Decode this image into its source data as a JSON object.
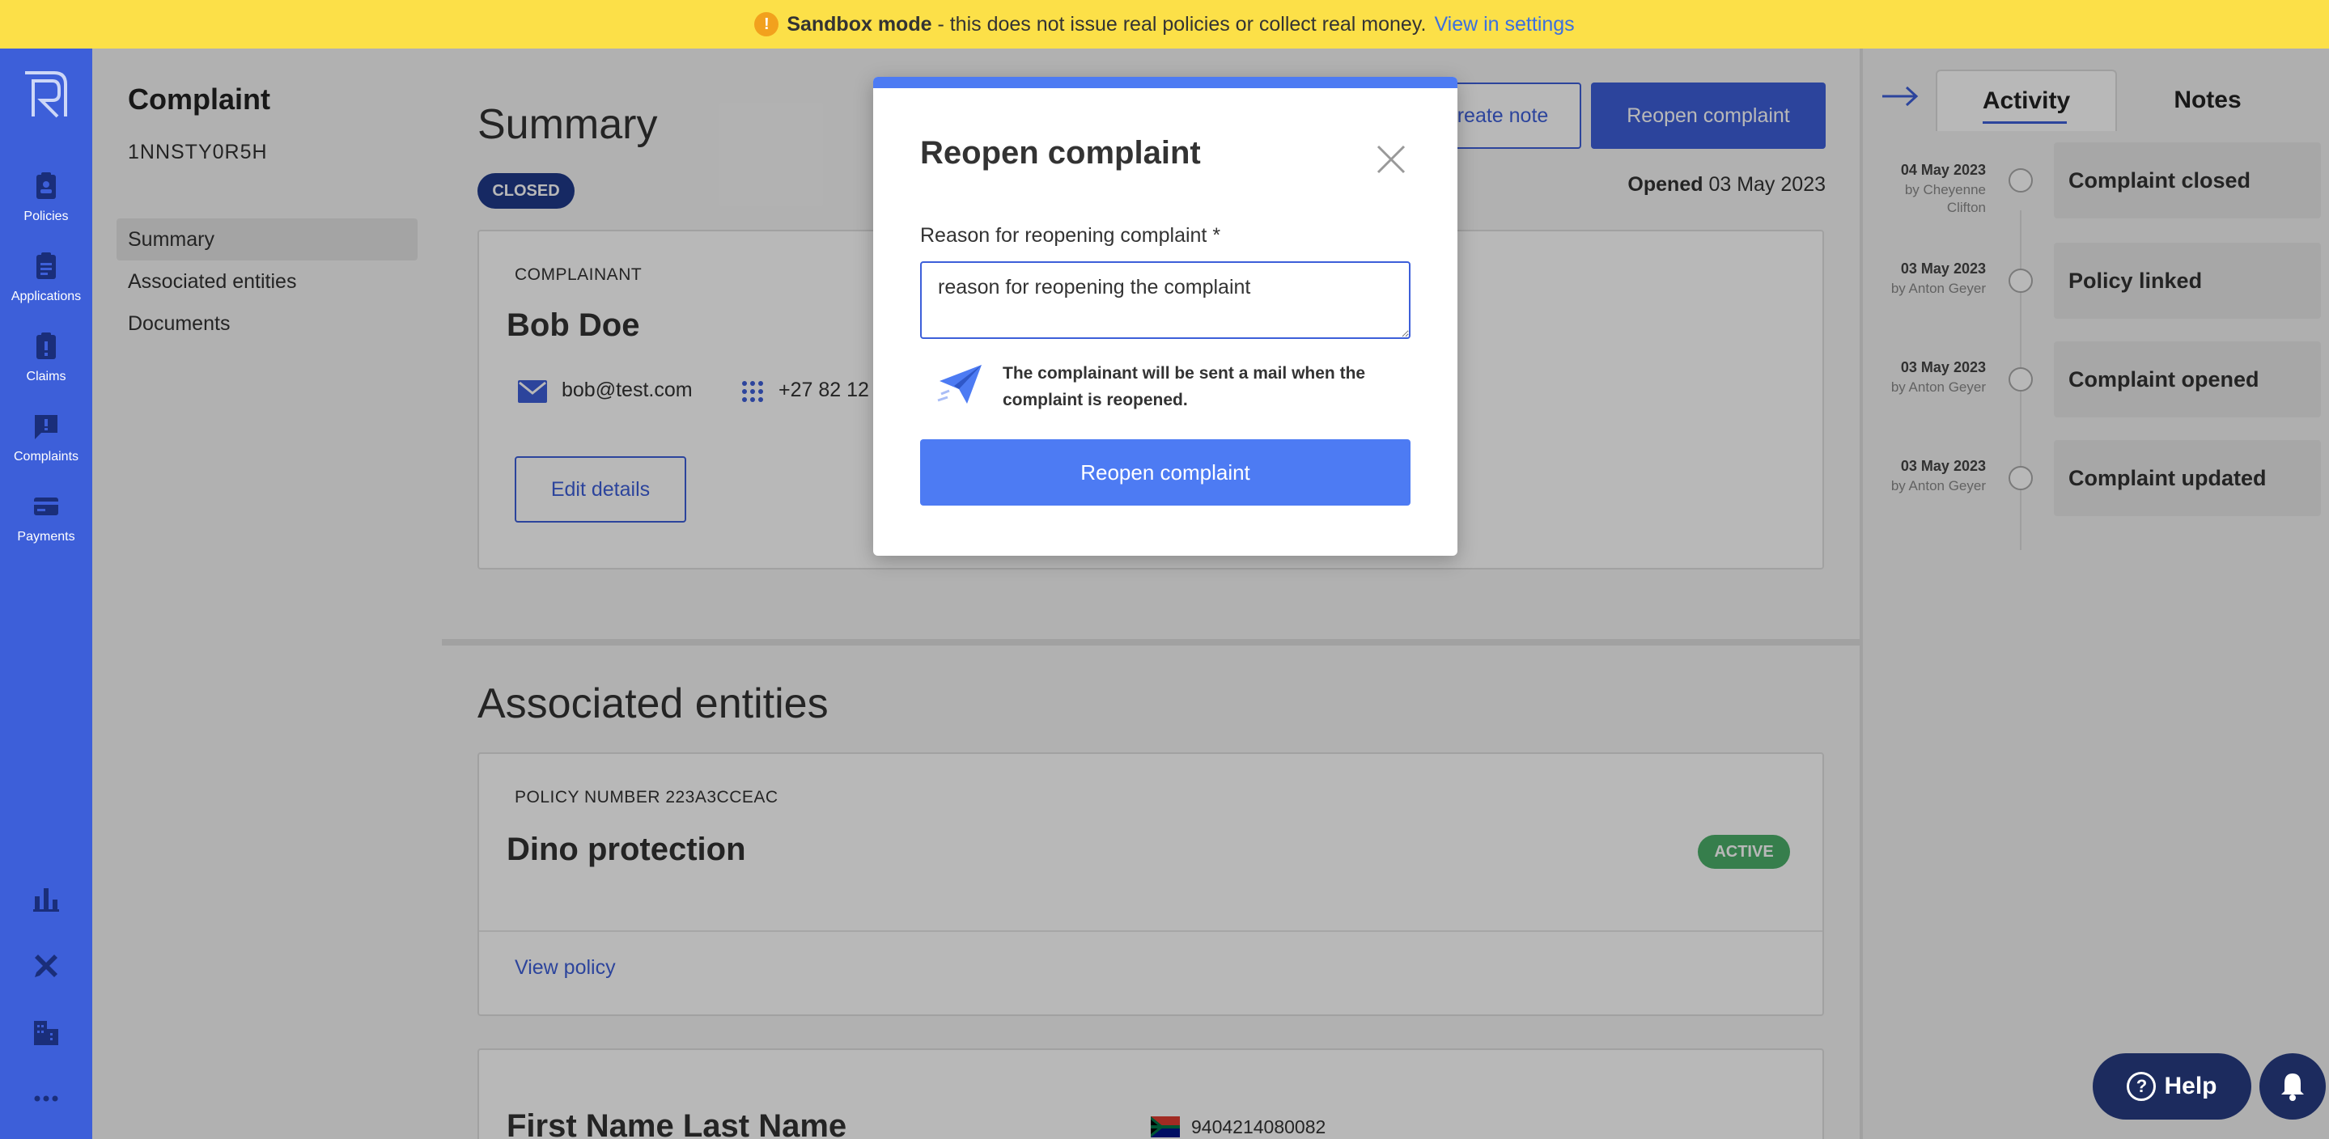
{
  "banner": {
    "title": "Sandbox mode",
    "text": " - this does not issue real policies or collect real money.",
    "link": "View in settings"
  },
  "rail": {
    "items": [
      {
        "label": "Policies",
        "icon": "policies-icon"
      },
      {
        "label": "Applications",
        "icon": "applications-icon"
      },
      {
        "label": "Claims",
        "icon": "claims-icon"
      },
      {
        "label": "Complaints",
        "icon": "complaints-icon"
      },
      {
        "label": "Payments",
        "icon": "payments-icon"
      }
    ]
  },
  "sidebar": {
    "title": "Complaint",
    "reference": "1NNSTY0R5H",
    "menu": [
      "Summary",
      "Associated entities",
      "Documents"
    ]
  },
  "summary": {
    "heading": "Summary",
    "status": "CLOSED",
    "opened_label": "Opened",
    "opened_date": "03 May 2023",
    "create_note": "Create note",
    "reopen": "Reopen complaint",
    "complainant_label": "COMPLAINANT",
    "complainant_name": "Bob Doe",
    "email": "bob@test.com",
    "phone": "+27 82 12",
    "edit": "Edit details"
  },
  "entities": {
    "heading": "Associated entities",
    "policy_label": "POLICY NUMBER 223A3CCEAC",
    "policy_name": "Dino protection",
    "policy_status": "ACTIVE",
    "view_policy": "View policy",
    "person_name": "First Name Last Name",
    "id_number": "9404214080082"
  },
  "activity": {
    "tabs": [
      "Activity",
      "Notes"
    ],
    "events": [
      {
        "date": "04 May 2023",
        "by": "by Cheyenne Clifton",
        "title": "Complaint closed"
      },
      {
        "date": "03 May 2023",
        "by": "by Anton Geyer",
        "title": "Policy linked"
      },
      {
        "date": "03 May 2023",
        "by": "by Anton Geyer",
        "title": "Complaint opened"
      },
      {
        "date": "03 May 2023",
        "by": "by Anton Geyer",
        "title": "Complaint updated"
      }
    ]
  },
  "modal": {
    "title": "Reopen complaint",
    "field_label": "Reason for reopening complaint *",
    "field_value": "reason for reopening the complaint",
    "note": "The complainant will be sent a mail when the complaint is reopened.",
    "submit": "Reopen complaint"
  },
  "help": {
    "label": "Help"
  },
  "colors": {
    "primary": "#3d5fd9",
    "banner": "#fce048",
    "active": "#4caf6a",
    "closed": "#1f3a8a"
  }
}
